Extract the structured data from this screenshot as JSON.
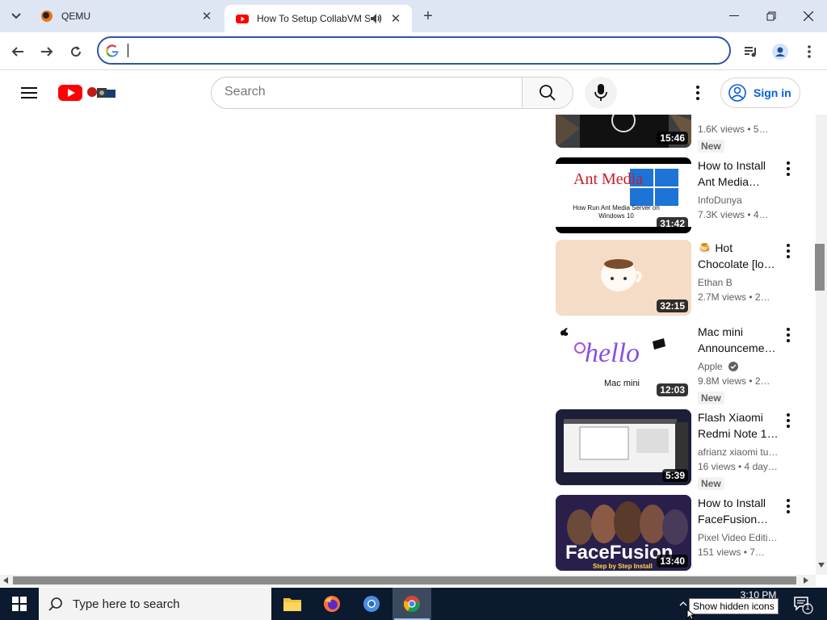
{
  "browser": {
    "tabs": [
      {
        "title": "QEMU",
        "active": false
      },
      {
        "title": "How To Setup CollabVM Se",
        "active": true
      }
    ],
    "omnibox_value": ""
  },
  "youtube": {
    "search_placeholder": "Search",
    "sign_in_label": "Sign in"
  },
  "videos": [
    {
      "title_lines": [
        "",
        ""
      ],
      "channel": "",
      "meta": "1.6K views • 5…",
      "badge": "New",
      "duration": "15:46",
      "thumb_color": "#2c3438"
    },
    {
      "title_lines": [
        "How to Install",
        "Ant Media…"
      ],
      "channel": "InfoDunya",
      "meta": "7.3K views • 4…",
      "badge": "",
      "duration": "31:42",
      "thumb_caption": "How Run Ant Media Server on Windows 10",
      "thumb_logo_text": "Ant Media",
      "thumb_color": "#ffffff"
    },
    {
      "title_lines": [
        "🍮 Hot",
        "Chocolate [lo…"
      ],
      "channel": "Ethan B",
      "meta": "2.7M views • 2…",
      "badge": "",
      "duration": "32:15",
      "thumb_color": "#f4dcc6"
    },
    {
      "title_lines": [
        "Mac mini",
        "Announceme…"
      ],
      "channel": "Apple",
      "verified": true,
      "meta": "9.8M views • 2…",
      "badge": "New",
      "duration": "12:03",
      "thumb_text": "hello",
      "thumb_caption": "Mac mini",
      "thumb_color": "#ffffff"
    },
    {
      "title_lines": [
        "Flash Xiaomi",
        "Redmi Note 1…"
      ],
      "channel": "afrianz xiaomi tu…",
      "meta": "16 views • 4 day…",
      "badge": "New",
      "duration": "5:39",
      "thumb_color": "#1c1e3a"
    },
    {
      "title_lines": [
        "How to Install",
        "FaceFusion…"
      ],
      "channel": "Pixel Video Editin…",
      "meta": "151 views • 7…",
      "badge": "",
      "duration": "13:40",
      "thumb_text": "FaceFusion",
      "thumb_caption": "Step by Step Install",
      "thumb_color": "#2a1f4a"
    }
  ],
  "taskbar": {
    "search_placeholder": "Type here to search",
    "clock_time": "3:10 PM",
    "tooltip": "Show hidden icons",
    "notification_count": "1"
  }
}
